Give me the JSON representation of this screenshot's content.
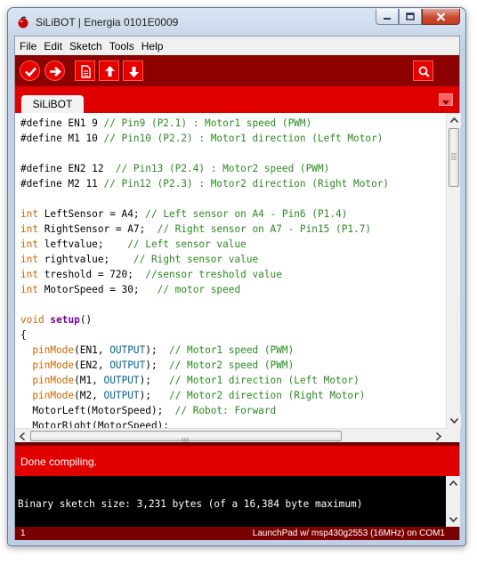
{
  "window": {
    "title": "SiLiBOT | Energia 0101E0009"
  },
  "menu": [
    "File",
    "Edit",
    "Sketch",
    "Tools",
    "Help"
  ],
  "toolbar": {
    "buttons": [
      "verify-icon",
      "upload-icon",
      "new-icon",
      "open-icon",
      "save-icon",
      "serial-monitor-icon"
    ]
  },
  "tab": {
    "label": "SiLiBOT"
  },
  "code_lines": [
    [
      [
        "c-plain",
        "#define EN1 9 "
      ],
      [
        "c-cm",
        "// Pin9 (P2.1) : Motor1 speed (PWM)"
      ]
    ],
    [
      [
        "c-plain",
        "#define M1 10 "
      ],
      [
        "c-cm",
        "// Pin10 (P2.2) : Motor1 direction (Left Motor)"
      ]
    ],
    [
      [
        "c-plain",
        ""
      ]
    ],
    [
      [
        "c-plain",
        "#define EN2 12  "
      ],
      [
        "c-cm",
        "// Pin13 (P2.4) : Motor2 speed (PWM)"
      ]
    ],
    [
      [
        "c-plain",
        "#define M2 11 "
      ],
      [
        "c-cm",
        "// Pin12 (P2.3) : Motor2 direction (Right Motor)"
      ]
    ],
    [
      [
        "c-plain",
        ""
      ]
    ],
    [
      [
        "c-kw",
        "int"
      ],
      [
        "c-plain",
        " LeftSensor = A4; "
      ],
      [
        "c-cm",
        "// Left sensor on A4 - Pin6 (P1.4)"
      ]
    ],
    [
      [
        "c-kw",
        "int"
      ],
      [
        "c-plain",
        " RightSensor = A7;  "
      ],
      [
        "c-cm",
        "// Right sensor on A7 - Pin15 (P1.7)"
      ]
    ],
    [
      [
        "c-kw",
        "int"
      ],
      [
        "c-plain",
        " leftvalue;    "
      ],
      [
        "c-cm",
        "// Left sensor value"
      ]
    ],
    [
      [
        "c-kw",
        "int"
      ],
      [
        "c-plain",
        " rightvalue;    "
      ],
      [
        "c-cm",
        "// Right sensor value"
      ]
    ],
    [
      [
        "c-kw",
        "int"
      ],
      [
        "c-plain",
        " treshold = 720;  "
      ],
      [
        "c-cm",
        "//sensor treshold value"
      ]
    ],
    [
      [
        "c-kw",
        "int"
      ],
      [
        "c-plain",
        " MotorSpeed = 30;   "
      ],
      [
        "c-cm",
        "// motor speed"
      ]
    ],
    [
      [
        "c-plain",
        ""
      ]
    ],
    [
      [
        "c-vd",
        "void"
      ],
      [
        "c-plain",
        " "
      ],
      [
        "c-bd",
        "setup"
      ],
      [
        "c-plain",
        "()"
      ]
    ],
    [
      [
        "c-plain",
        "{"
      ]
    ],
    [
      [
        "c-plain",
        "  "
      ],
      [
        "c-fn",
        "pinMode"
      ],
      [
        "c-plain",
        "(EN1, "
      ],
      [
        "c-bl",
        "OUTPUT"
      ],
      [
        "c-plain",
        ");  "
      ],
      [
        "c-cm",
        "// Motor1 speed (PWM)"
      ]
    ],
    [
      [
        "c-plain",
        "  "
      ],
      [
        "c-fn",
        "pinMode"
      ],
      [
        "c-plain",
        "(EN2, "
      ],
      [
        "c-bl",
        "OUTPUT"
      ],
      [
        "c-plain",
        ");  "
      ],
      [
        "c-cm",
        "// Motor2 speed (PWM)"
      ]
    ],
    [
      [
        "c-plain",
        "  "
      ],
      [
        "c-fn",
        "pinMode"
      ],
      [
        "c-plain",
        "(M1, "
      ],
      [
        "c-bl",
        "OUTPUT"
      ],
      [
        "c-plain",
        ");   "
      ],
      [
        "c-cm",
        "// Motor1 direction (Left Motor)"
      ]
    ],
    [
      [
        "c-plain",
        "  "
      ],
      [
        "c-fn",
        "pinMode"
      ],
      [
        "c-plain",
        "(M2, "
      ],
      [
        "c-bl",
        "OUTPUT"
      ],
      [
        "c-plain",
        ");   "
      ],
      [
        "c-cm",
        "// Motor2 direction (Right Motor)"
      ]
    ],
    [
      [
        "c-plain",
        "  MotorLeft(MotorSpeed);  "
      ],
      [
        "c-cm",
        "// Robot: Forward"
      ]
    ],
    [
      [
        "c-plain",
        "  MotorRight(MotorSpeed);"
      ]
    ]
  ],
  "status": {
    "message": "Done compiling."
  },
  "console": {
    "output": "Binary sketch size: 3,231 bytes (of a 16,384 byte maximum)"
  },
  "footer": {
    "line_number": "1",
    "board": "LaunchPad w/ msp430g2553 (16MHz) on COM1"
  },
  "colors": {
    "toolbar_bg": "#8d0000",
    "accent_red": "#e00000",
    "comment": "#2a8a20",
    "keyword": "#cc6600",
    "constant": "#006699"
  }
}
